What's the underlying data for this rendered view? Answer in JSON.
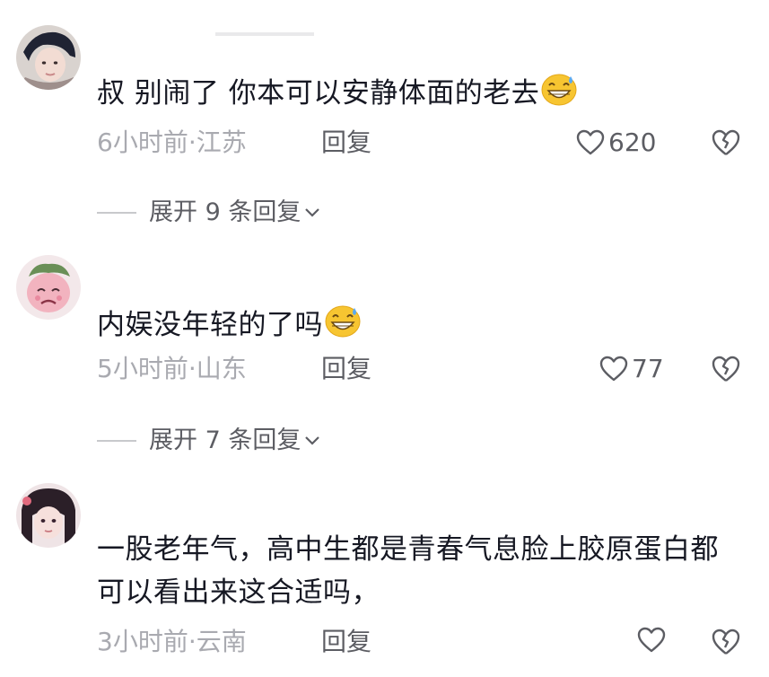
{
  "comments": [
    {
      "text": "叔 别闹了 你本可以安静体面的老去",
      "emoji": "grin-sweat",
      "time": "6小时前",
      "location": "江苏",
      "reply_label": "回复",
      "likes": "620",
      "expand_label": "展开 9 条回复"
    },
    {
      "text": "内娱没年轻的了吗",
      "emoji": "grin-sweat",
      "time": "5小时前",
      "location": "山东",
      "reply_label": "回复",
      "likes": "77",
      "expand_label": "展开 7 条回复"
    },
    {
      "text": "一股老年气，高中生都是青春气息脸上胶原蛋白都可以看出来这合适吗，",
      "time": "3小时前",
      "location": "云南",
      "reply_label": "回复",
      "likes": ""
    }
  ],
  "colors": {
    "text": "#161823",
    "meta": "#a9aab0",
    "action": "#5c5d63",
    "emoji": "#f7c531"
  }
}
